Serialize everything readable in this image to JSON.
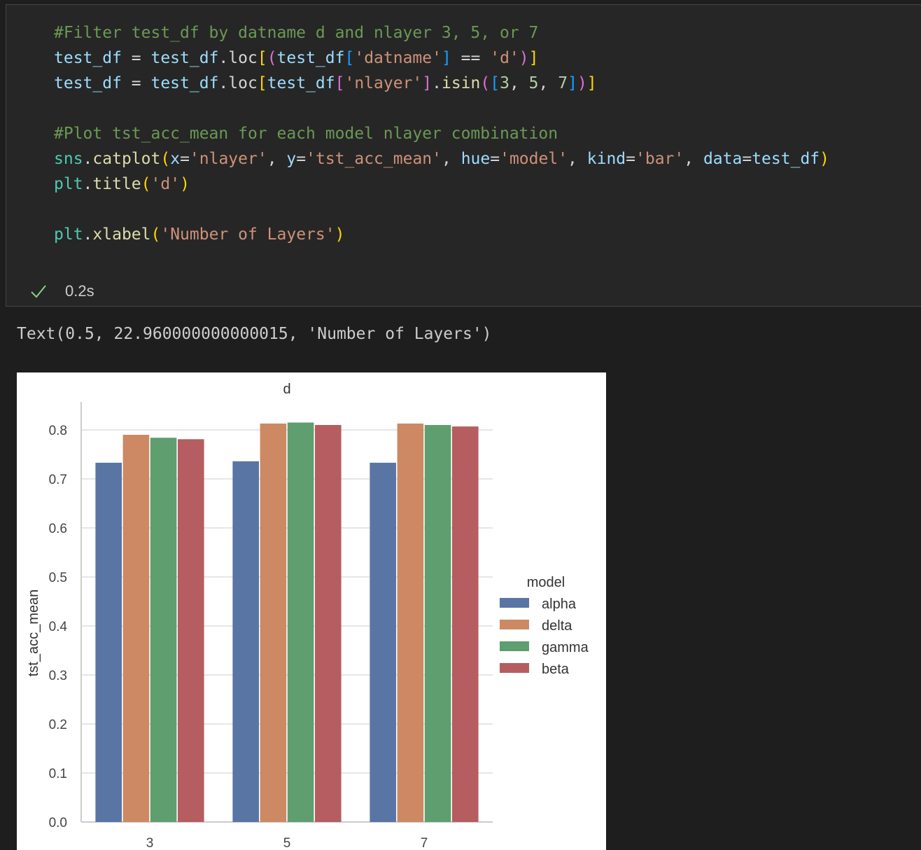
{
  "code_cell": {
    "lines": [
      [
        {
          "t": "#Filter test_df by datname d and nlayer 3, 5, or 7",
          "c": "#6a9955"
        }
      ],
      [
        {
          "t": "test_df",
          "c": "#9cdcfe"
        },
        {
          "t": " = ",
          "c": "#d4d4d4"
        },
        {
          "t": "test_df",
          "c": "#9cdcfe"
        },
        {
          "t": ".",
          "c": "#d4d4d4"
        },
        {
          "t": "loc",
          "c": "#d4d4d4"
        },
        {
          "t": "[",
          "c": "#ffd700"
        },
        {
          "t": "(",
          "c": "#da70d6"
        },
        {
          "t": "test_df",
          "c": "#9cdcfe"
        },
        {
          "t": "[",
          "c": "#179fff"
        },
        {
          "t": "'datname'",
          "c": "#ce9178"
        },
        {
          "t": "]",
          "c": "#179fff"
        },
        {
          "t": " == ",
          "c": "#d4d4d4"
        },
        {
          "t": "'d'",
          "c": "#ce9178"
        },
        {
          "t": ")",
          "c": "#da70d6"
        },
        {
          "t": "]",
          "c": "#ffd700"
        }
      ],
      [
        {
          "t": "test_df",
          "c": "#9cdcfe"
        },
        {
          "t": " = ",
          "c": "#d4d4d4"
        },
        {
          "t": "test_df",
          "c": "#9cdcfe"
        },
        {
          "t": ".",
          "c": "#d4d4d4"
        },
        {
          "t": "loc",
          "c": "#d4d4d4"
        },
        {
          "t": "[",
          "c": "#ffd700"
        },
        {
          "t": "test_df",
          "c": "#9cdcfe"
        },
        {
          "t": "[",
          "c": "#da70d6"
        },
        {
          "t": "'nlayer'",
          "c": "#ce9178"
        },
        {
          "t": "]",
          "c": "#da70d6"
        },
        {
          "t": ".",
          "c": "#d4d4d4"
        },
        {
          "t": "isin",
          "c": "#dcdcaa"
        },
        {
          "t": "(",
          "c": "#da70d6"
        },
        {
          "t": "[",
          "c": "#179fff"
        },
        {
          "t": "3",
          "c": "#b5cea8"
        },
        {
          "t": ", ",
          "c": "#d4d4d4"
        },
        {
          "t": "5",
          "c": "#b5cea8"
        },
        {
          "t": ", ",
          "c": "#d4d4d4"
        },
        {
          "t": "7",
          "c": "#b5cea8"
        },
        {
          "t": "]",
          "c": "#179fff"
        },
        {
          "t": ")",
          "c": "#da70d6"
        },
        {
          "t": "]",
          "c": "#ffd700"
        }
      ],
      [],
      [
        {
          "t": "#Plot tst_acc_mean for each model nlayer combination",
          "c": "#6a9955"
        }
      ],
      [
        {
          "t": "sns",
          "c": "#4ec9b0"
        },
        {
          "t": ".",
          "c": "#d4d4d4"
        },
        {
          "t": "catplot",
          "c": "#dcdcaa"
        },
        {
          "t": "(",
          "c": "#ffd700"
        },
        {
          "t": "x",
          "c": "#9cdcfe"
        },
        {
          "t": "=",
          "c": "#d4d4d4"
        },
        {
          "t": "'nlayer'",
          "c": "#ce9178"
        },
        {
          "t": ", ",
          "c": "#d4d4d4"
        },
        {
          "t": "y",
          "c": "#9cdcfe"
        },
        {
          "t": "=",
          "c": "#d4d4d4"
        },
        {
          "t": "'tst_acc_mean'",
          "c": "#ce9178"
        },
        {
          "t": ", ",
          "c": "#d4d4d4"
        },
        {
          "t": "hue",
          "c": "#9cdcfe"
        },
        {
          "t": "=",
          "c": "#d4d4d4"
        },
        {
          "t": "'model'",
          "c": "#ce9178"
        },
        {
          "t": ", ",
          "c": "#d4d4d4"
        },
        {
          "t": "kind",
          "c": "#9cdcfe"
        },
        {
          "t": "=",
          "c": "#d4d4d4"
        },
        {
          "t": "'bar'",
          "c": "#ce9178"
        },
        {
          "t": ", ",
          "c": "#d4d4d4"
        },
        {
          "t": "data",
          "c": "#9cdcfe"
        },
        {
          "t": "=",
          "c": "#d4d4d4"
        },
        {
          "t": "test_df",
          "c": "#9cdcfe"
        },
        {
          "t": ")",
          "c": "#ffd700"
        }
      ],
      [
        {
          "t": "plt",
          "c": "#4ec9b0"
        },
        {
          "t": ".",
          "c": "#d4d4d4"
        },
        {
          "t": "title",
          "c": "#dcdcaa"
        },
        {
          "t": "(",
          "c": "#ffd700"
        },
        {
          "t": "'d'",
          "c": "#ce9178"
        },
        {
          "t": ")",
          "c": "#ffd700"
        }
      ],
      [],
      [
        {
          "t": "plt",
          "c": "#4ec9b0"
        },
        {
          "t": ".",
          "c": "#d4d4d4"
        },
        {
          "t": "xlabel",
          "c": "#dcdcaa"
        },
        {
          "t": "(",
          "c": "#ffd700"
        },
        {
          "t": "'Number of Layers'",
          "c": "#ce9178"
        },
        {
          "t": ")",
          "c": "#ffd700"
        }
      ]
    ]
  },
  "status": {
    "icon": "check-icon",
    "time": "0.2s",
    "color": "#89d185"
  },
  "output": {
    "text": "Text(0.5, 22.960000000000015, 'Number of Layers')"
  },
  "chart_data": {
    "type": "bar",
    "title": "d",
    "xlabel": "",
    "ylabel": "tst_acc_mean",
    "categories": [
      "3",
      "5",
      "7"
    ],
    "ylim": [
      0,
      0.8
    ],
    "yticks": [
      "0.0",
      "0.1",
      "0.2",
      "0.3",
      "0.4",
      "0.5",
      "0.6",
      "0.7",
      "0.8"
    ],
    "legend_title": "model",
    "legend_position": "right",
    "grid": true,
    "series": [
      {
        "name": "alpha",
        "color": "#5975a4",
        "values": [
          0.733,
          0.736,
          0.733
        ]
      },
      {
        "name": "delta",
        "color": "#cc8963",
        "values": [
          0.79,
          0.813,
          0.813
        ]
      },
      {
        "name": "gamma",
        "color": "#5f9e6e",
        "values": [
          0.784,
          0.815,
          0.81
        ]
      },
      {
        "name": "beta",
        "color": "#b55d60",
        "values": [
          0.781,
          0.81,
          0.807
        ]
      }
    ]
  }
}
